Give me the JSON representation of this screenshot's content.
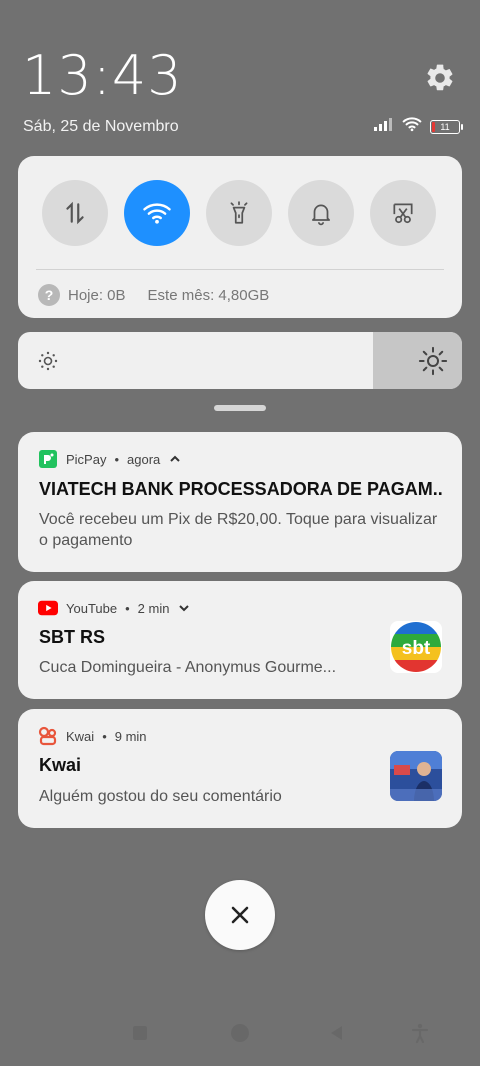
{
  "status": {
    "time": "13:43",
    "date": "Sáb, 25 de Novembro",
    "battery_level": "11",
    "battery_fraction": 0.11
  },
  "quick_settings": {
    "tiles": [
      {
        "name": "mobile-data",
        "icon": "data-arrows-icon",
        "active": false
      },
      {
        "name": "wifi",
        "icon": "wifi-icon",
        "active": true
      },
      {
        "name": "flashlight",
        "icon": "flashlight-icon",
        "active": false
      },
      {
        "name": "sound",
        "icon": "bell-icon",
        "active": false
      },
      {
        "name": "screenshot",
        "icon": "scissors-icon",
        "active": false
      }
    ],
    "data_today": "Hoje: 0B",
    "data_month": "Este mês: 4,80GB"
  },
  "brightness": {
    "level": 0.8
  },
  "notifications": [
    {
      "app": "PicPay",
      "time": "agora",
      "title": "VIATECH BANK PROCESSADORA DE PAGAM..",
      "body": "Você recebeu um Pix de R$20,00. Toque para visualizar o pagamento"
    },
    {
      "app": "YouTube",
      "time": "2 min",
      "title": "SBT RS",
      "body": "Cuca Domingueira - Anonymus Gourme...",
      "thumb_text": "sbt"
    },
    {
      "app": "Kwai",
      "time": "9 min",
      "title": "Kwai",
      "body": "Alguém gostou do seu comentário"
    }
  ],
  "colors": {
    "accent": "#1E90FF",
    "background": "#717171",
    "card": "#F1F1F1",
    "picpay": "#21C25E",
    "youtube": "#FF0000",
    "kwai": "#E8553B"
  }
}
